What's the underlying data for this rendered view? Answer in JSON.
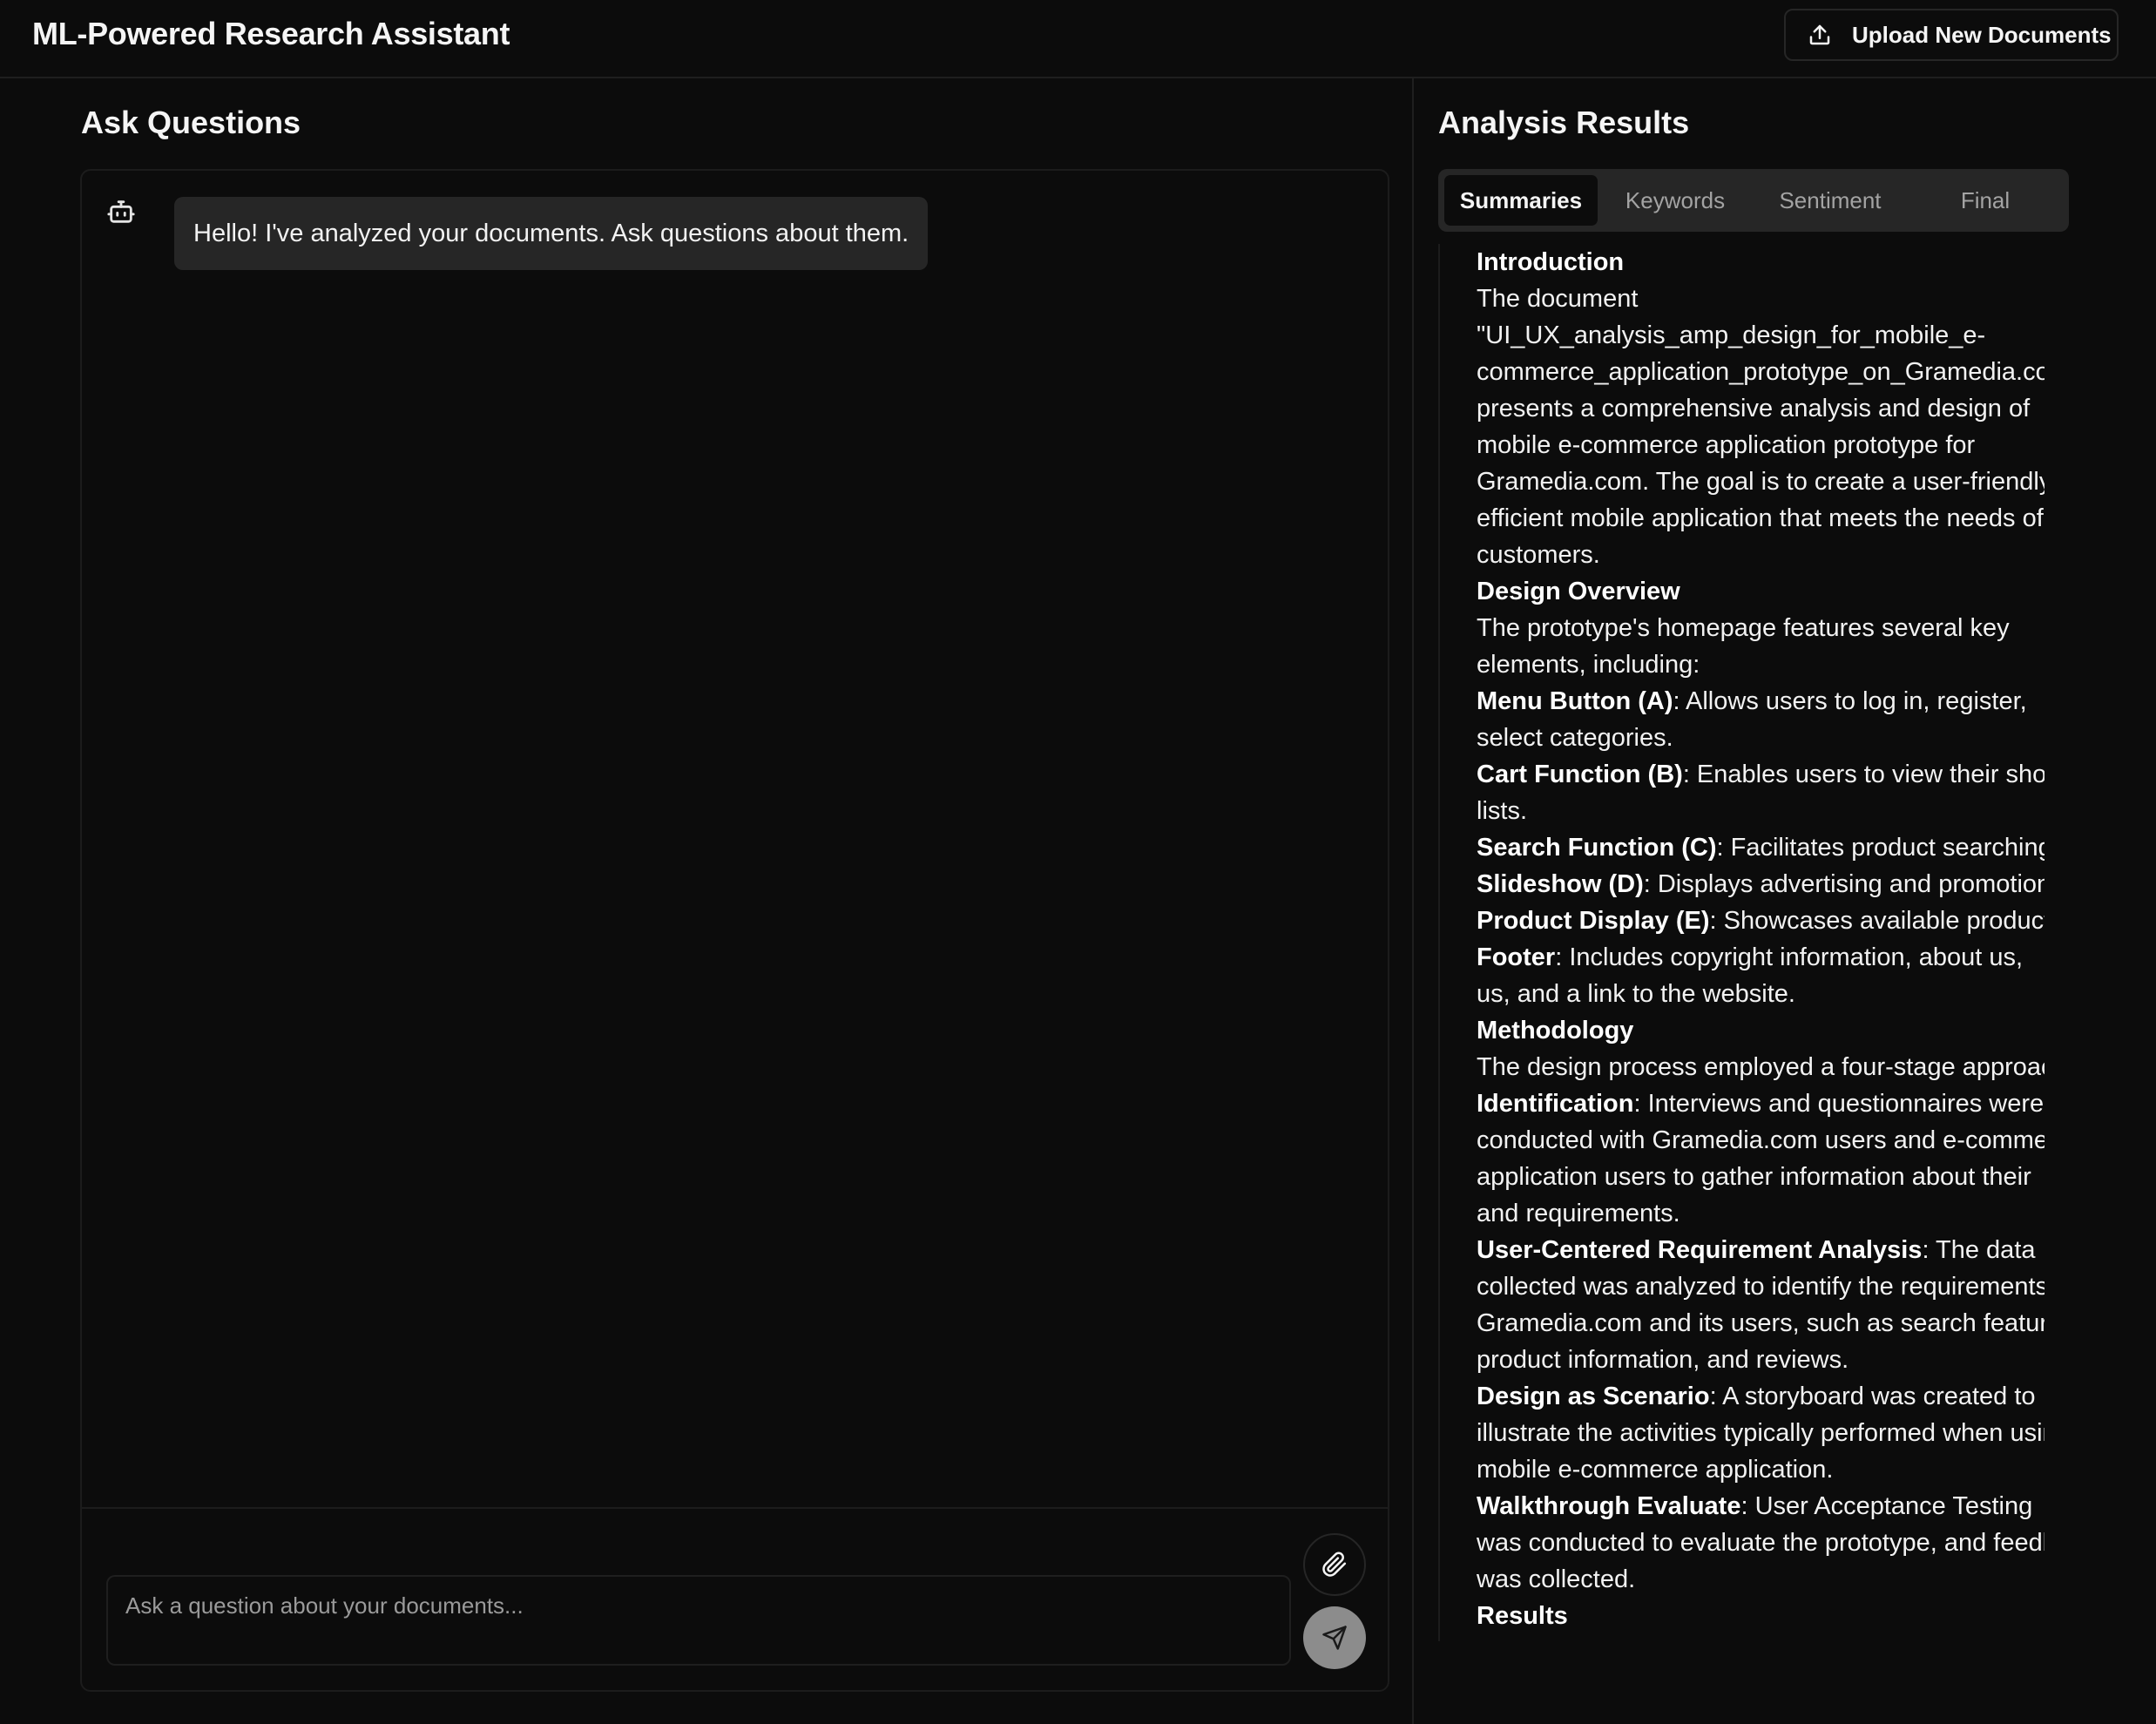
{
  "header": {
    "app_title": "ML-Powered Research Assistant",
    "upload_label": "Upload New Documents",
    "upload_icon": "upload-icon"
  },
  "chat": {
    "title": "Ask Questions",
    "bot_icon": "bot-icon",
    "message": "Hello! I've analyzed your documents. Ask questions about them.",
    "input_placeholder": "Ask a question about your documents...",
    "input_value": "",
    "attach_icon": "paperclip-icon",
    "send_icon": "send-icon"
  },
  "analysis": {
    "title": "Analysis Results",
    "tabs": [
      {
        "label": "Summaries",
        "active": true
      },
      {
        "label": "Keywords",
        "active": false
      },
      {
        "label": "Sentiment",
        "active": false
      },
      {
        "label": "Final",
        "active": false
      }
    ],
    "summary_lines": [
      {
        "bold": "Introduction",
        "text": ""
      },
      {
        "bold": "",
        "text": "The document"
      },
      {
        "bold": "",
        "text": "\"UI_UX_analysis_amp_design_for_mobile_e-"
      },
      {
        "bold": "",
        "text": "commerce_application_prototype_on_Gramedia.co"
      },
      {
        "bold": "",
        "text": "presents a comprehensive analysis and design of"
      },
      {
        "bold": "",
        "text": "mobile e-commerce application prototype for"
      },
      {
        "bold": "",
        "text": "Gramedia.com. The goal is to create a user-friendly"
      },
      {
        "bold": "",
        "text": "efficient mobile application that meets the needs of"
      },
      {
        "bold": "",
        "text": "customers."
      },
      {
        "bold": "Design Overview",
        "text": ""
      },
      {
        "bold": "",
        "text": "The prototype's homepage features several key"
      },
      {
        "bold": "",
        "text": "elements, including:"
      },
      {
        "bold": "Menu Button (A)",
        "text": ": Allows users to log in, register,"
      },
      {
        "bold": "",
        "text": "select categories."
      },
      {
        "bold": "Cart Function (B)",
        "text": ": Enables users to view their shopping"
      },
      {
        "bold": "",
        "text": "lists."
      },
      {
        "bold": "Search Function (C)",
        "text": ": Facilitates product searching"
      },
      {
        "bold": "Slideshow (D)",
        "text": ": Displays advertising and promotions"
      },
      {
        "bold": "Product Display (E)",
        "text": ": Showcases available products"
      },
      {
        "bold": "Footer",
        "text": ": Includes copyright information, about us,"
      },
      {
        "bold": "",
        "text": "us, and a link to the website."
      },
      {
        "bold": "Methodology",
        "text": ""
      },
      {
        "bold": "",
        "text": "The design process employed a four-stage approach"
      },
      {
        "bold": "Identification",
        "text": ": Interviews and questionnaires were"
      },
      {
        "bold": "",
        "text": "conducted with Gramedia.com users and e-commerce"
      },
      {
        "bold": "",
        "text": "application users to gather information about their"
      },
      {
        "bold": "",
        "text": "and requirements."
      },
      {
        "bold": "User-Centered Requirement Analysis",
        "text": ": The data"
      },
      {
        "bold": "",
        "text": "collected was analyzed to identify the requirements"
      },
      {
        "bold": "",
        "text": "Gramedia.com and its users, such as search features"
      },
      {
        "bold": "",
        "text": "product information, and reviews."
      },
      {
        "bold": "Design as Scenario",
        "text": ": A storyboard was created to"
      },
      {
        "bold": "",
        "text": "illustrate the activities typically performed when using"
      },
      {
        "bold": "",
        "text": "mobile e-commerce application."
      },
      {
        "bold": "Walkthrough Evaluate",
        "text": ": User Acceptance Testing"
      },
      {
        "bold": "",
        "text": "was conducted to evaluate the prototype, and feedback"
      },
      {
        "bold": "",
        "text": "was collected."
      },
      {
        "bold": "Results",
        "text": ""
      }
    ]
  },
  "colors": {
    "background": "#0c0c0c",
    "bubble": "#262626",
    "tabs_bg": "#262626",
    "send_button": "#8c8c8c",
    "border": "#1f1f1f"
  }
}
